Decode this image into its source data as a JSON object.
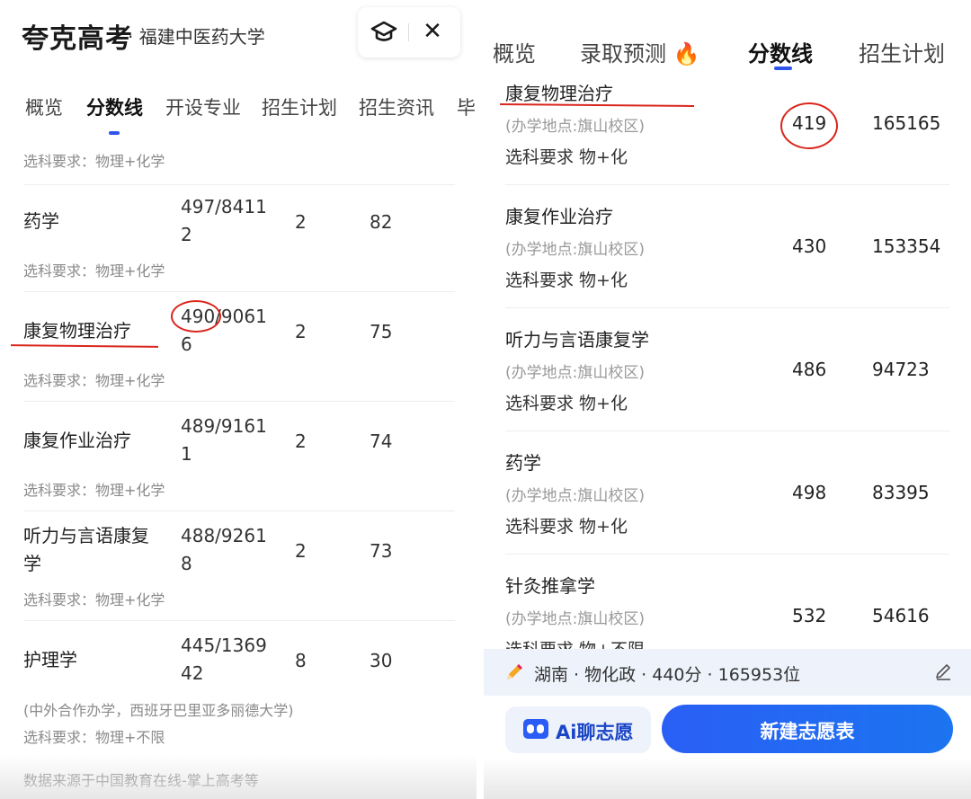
{
  "left": {
    "brand": "夸克高考",
    "brand_sub": "· 福建中医药大学",
    "header_icons": [
      "graduation-cap-icon",
      "close-icon"
    ],
    "close_glyph": "✕",
    "tabs": [
      "概览",
      "分数线",
      "开设专业",
      "招生计划",
      "招生资讯",
      "毕业"
    ],
    "active_tab": "分数线",
    "top_req": "选科要求：物理+化学",
    "rows": [
      {
        "name": "药学",
        "score": "497/84112",
        "plan": "2",
        "count": "82",
        "req": "选科要求：物理+化学"
      },
      {
        "name": "康复物理治疗",
        "score": "490/90616",
        "plan": "2",
        "count": "75",
        "req": "选科要求：物理+化学"
      },
      {
        "name": "康复作业治疗",
        "score": "489/91611",
        "plan": "2",
        "count": "74",
        "req": "选科要求：物理+化学"
      },
      {
        "name": "听力与言语康复学",
        "score": "488/92618",
        "plan": "2",
        "count": "73",
        "req": "选科要求：物理+化学"
      },
      {
        "name": "护理学",
        "score": "445/136942",
        "plan": "8",
        "count": "30",
        "note": "(中外合作办学，西班牙巴里亚多丽德大学)",
        "req": "选科要求：物理+不限"
      }
    ],
    "footer": "数据来源于中国教育在线-掌上高考等"
  },
  "right": {
    "tabs": [
      "概览",
      "录取预测",
      "分数线",
      "招生计划"
    ],
    "hot_icon": "🔥",
    "active_tab": "分数线",
    "rows": [
      {
        "name": "康复物理治疗",
        "location": "(办学地点:旗山校区)",
        "req": "选科要求 物+化",
        "score": "419",
        "rank": "165165"
      },
      {
        "name": "康复作业治疗",
        "location": "(办学地点:旗山校区)",
        "req": "选科要求 物+化",
        "score": "430",
        "rank": "153354"
      },
      {
        "name": "听力与言语康复学",
        "location": "(办学地点:旗山校区)",
        "req": "选科要求 物+化",
        "score": "486",
        "rank": "94723"
      },
      {
        "name": "药学",
        "location": "(办学地点:旗山校区)",
        "req": "选科要求 物+化",
        "score": "498",
        "rank": "83395"
      },
      {
        "name": "针灸推拿学",
        "location": "(办学地点:旗山校区)",
        "req": "选科要求 物+不限",
        "score": "532",
        "rank": "54616"
      }
    ],
    "profile": "湖南 · 物化政 · 440分 · 165953位",
    "ai_button": "Ai聊志愿",
    "new_button": "新建志愿表"
  },
  "colors": {
    "accent": "#2f54eb",
    "annotation": "#d9261c",
    "muted": "#8a8a8a"
  }
}
